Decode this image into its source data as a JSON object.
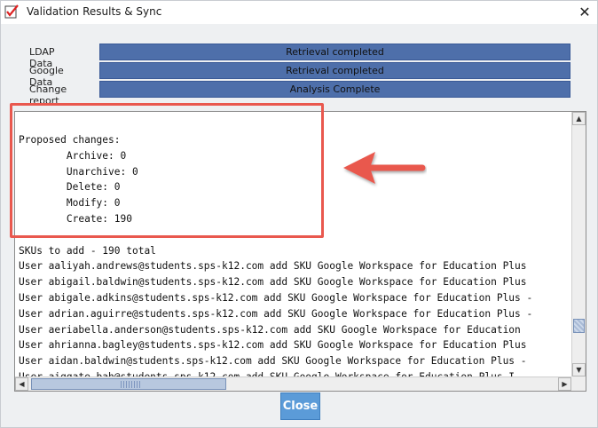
{
  "window": {
    "title": "Validation Results & Sync",
    "close_glyph": "✕"
  },
  "status": [
    {
      "label": "LDAP Data",
      "value": "Retrieval completed"
    },
    {
      "label": "Google Data",
      "value": "Retrieval completed"
    },
    {
      "label": "Change report",
      "value": "Analysis Complete"
    }
  ],
  "report": {
    "lines": [
      "Proposed changes:",
      "        Archive: 0",
      "        Unarchive: 0",
      "        Delete: 0",
      "        Modify: 0",
      "        Create: 190",
      "",
      "SKUs to add - 190 total",
      "User aaliyah.andrews@students.sps-k12.com add SKU Google Workspace for Education Plus",
      "User abigail.baldwin@students.sps-k12.com add SKU Google Workspace for Education Plus",
      "User abigale.adkins@students.sps-k12.com add SKU Google Workspace for Education Plus -",
      "User adrian.aguirre@students.sps-k12.com add SKU Google Workspace for Education Plus -",
      "User aeriabella.anderson@students.sps-k12.com add SKU Google Workspace for Education",
      "User ahrianna.bagley@students.sps-k12.com add SKU Google Workspace for Education Plus",
      "User aidan.baldwin@students.sps-k12.com add SKU Google Workspace for Education Plus -",
      "User aiggate bah@students sps-k12 com add SKU Google Workspace for Education Plus I"
    ],
    "scroll_position": 0.78
  },
  "buttons": {
    "close_label": "Close"
  },
  "annotation": {
    "color": "#e9584e"
  },
  "colors": {
    "status_bar": "#4e6faa",
    "close_button": "#5b9bd8"
  }
}
